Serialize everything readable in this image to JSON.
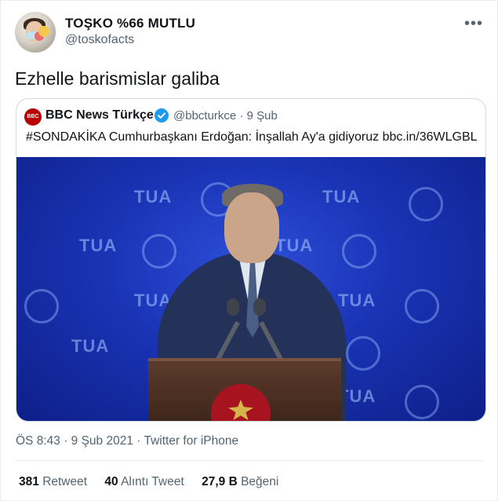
{
  "author": {
    "name": "TOŞKO %66 MUTLU",
    "handle": "@toskofacts"
  },
  "tweet": {
    "text": "Ezhelle barismislar galiba"
  },
  "quoted": {
    "logo_text": "BBC NEWS",
    "name": "BBC News Türkçe",
    "handle": "@bbcturkce",
    "dot": "·",
    "date": "9 Şub",
    "text": "#SONDAKİKA Cumhurbaşkanı Erdoğan: İnşallah Ay'a gidiyoruz bbc.in/36WLGBL",
    "backdrop_logo": "TUA"
  },
  "timestamp": {
    "time": "ÖS 8:43",
    "dot": "·",
    "date": "9 Şub 2021",
    "source": "Twitter for iPhone"
  },
  "stats": {
    "retweets_count": "381",
    "retweets_label": "Retweet",
    "quotes_count": "40",
    "quotes_label": "Alıntı Tweet",
    "likes_count": "27,9 B",
    "likes_label": "Beğeni"
  },
  "icons": {
    "more": "more-horizontal-icon",
    "verified": "verified-badge-icon"
  },
  "colors": {
    "text": "#0f1419",
    "secondary": "#536471",
    "verified": "#1d9bf0",
    "border": "#cfd9de",
    "bbc_red": "#b80000"
  }
}
